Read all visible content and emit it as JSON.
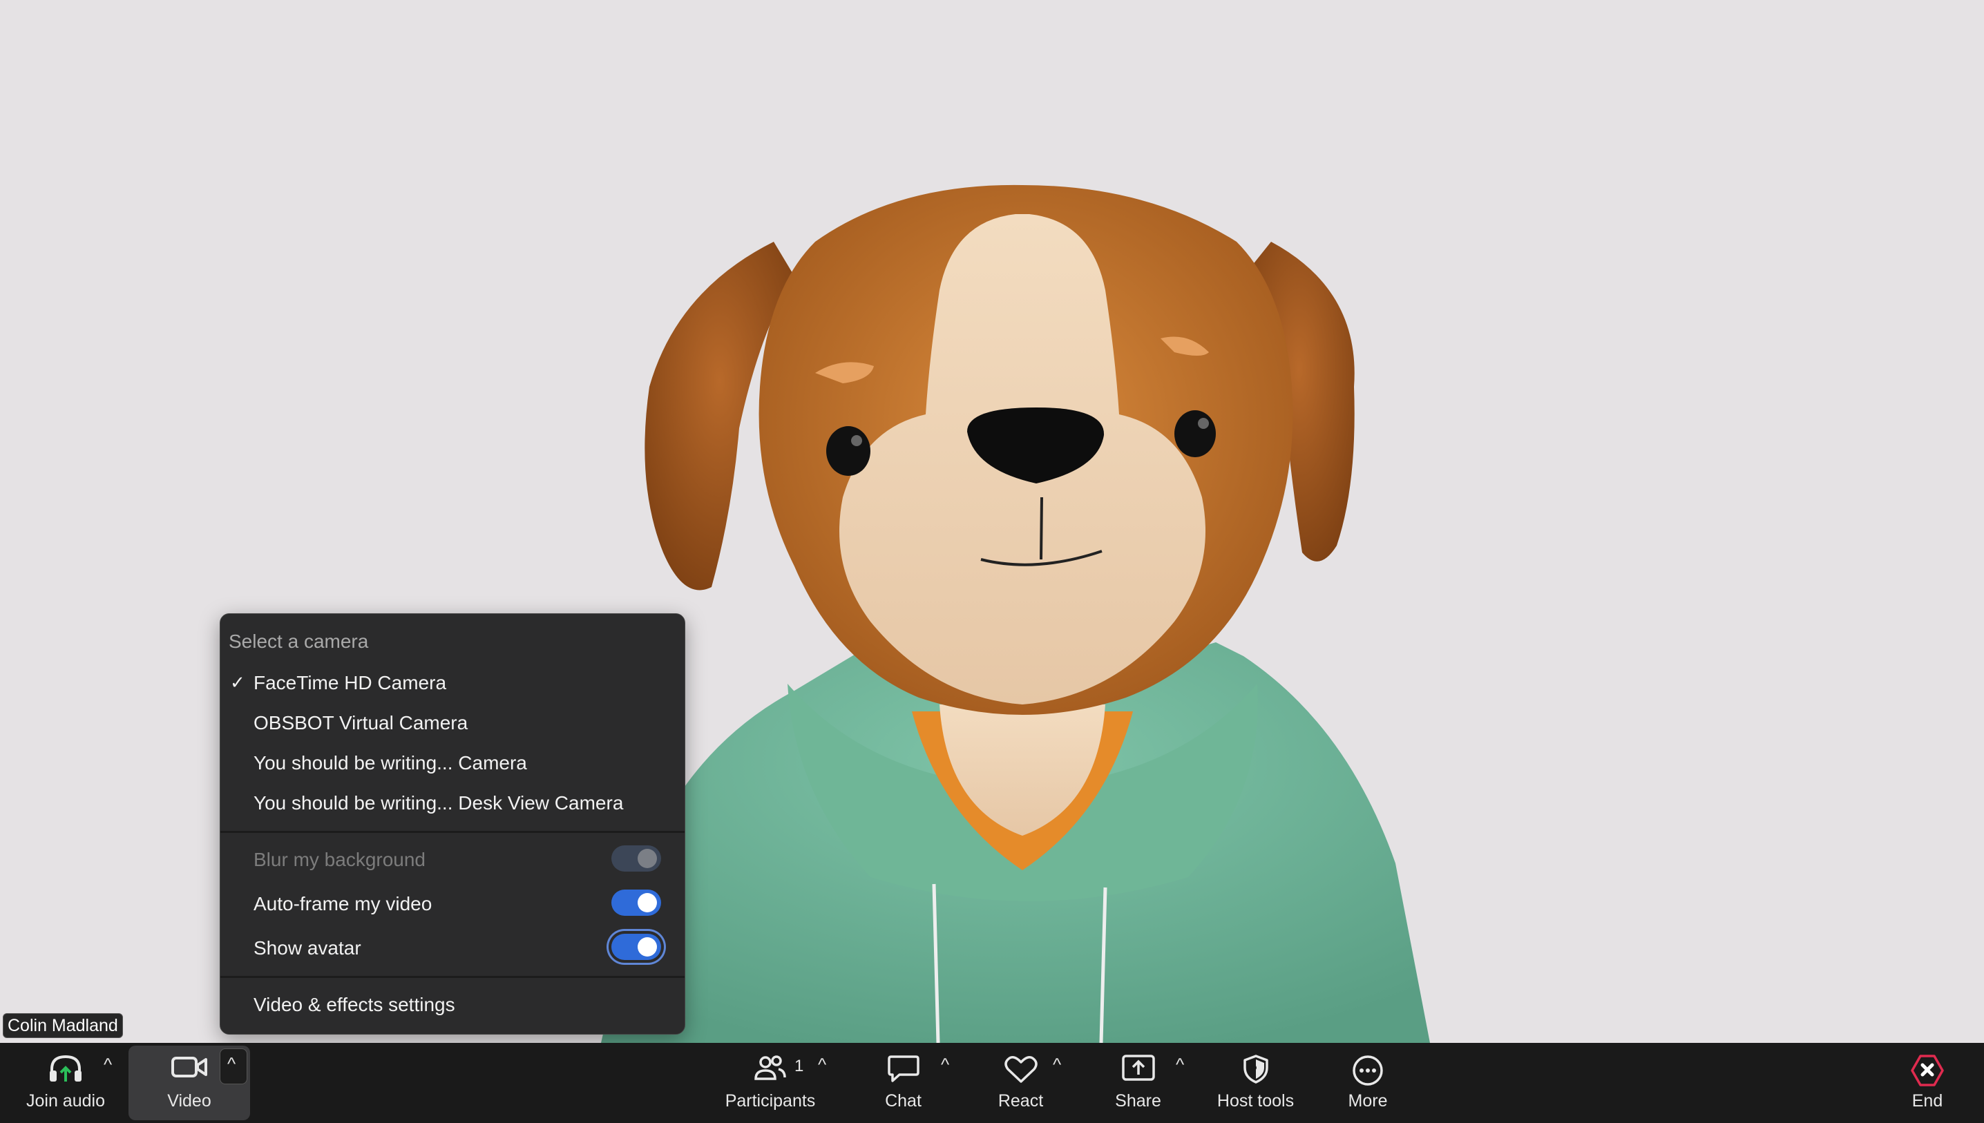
{
  "participant": {
    "name": "Colin Madland"
  },
  "camera_menu": {
    "header": "Select a camera",
    "cameras": [
      {
        "label": "FaceTime HD Camera",
        "selected": true
      },
      {
        "label": "OBSBOT Virtual Camera",
        "selected": false
      },
      {
        "label": "You should be writing... Camera",
        "selected": false
      },
      {
        "label": "You should be writing... Desk View Camera",
        "selected": false
      }
    ],
    "check_mark": "✓",
    "options": [
      {
        "label": "Blur my background",
        "enabled": false,
        "on": false
      },
      {
        "label": "Auto-frame my video",
        "enabled": true,
        "on": true
      },
      {
        "label": "Show avatar",
        "enabled": true,
        "on": true
      }
    ],
    "settings_label": "Video & effects settings"
  },
  "toolbar": {
    "join_audio": "Join audio",
    "video": "Video",
    "participants": "Participants",
    "participants_count": "1",
    "chat": "Chat",
    "react": "React",
    "share": "Share",
    "host_tools": "Host tools",
    "more": "More",
    "end": "End",
    "caret": "^"
  },
  "colors": {
    "accent": "#2f6bd9",
    "toolbar_bg": "#1a1a1a",
    "menu_bg": "#2b2b2c",
    "stage_bg": "#e5e2e4",
    "end_red": "#e02b4f"
  }
}
